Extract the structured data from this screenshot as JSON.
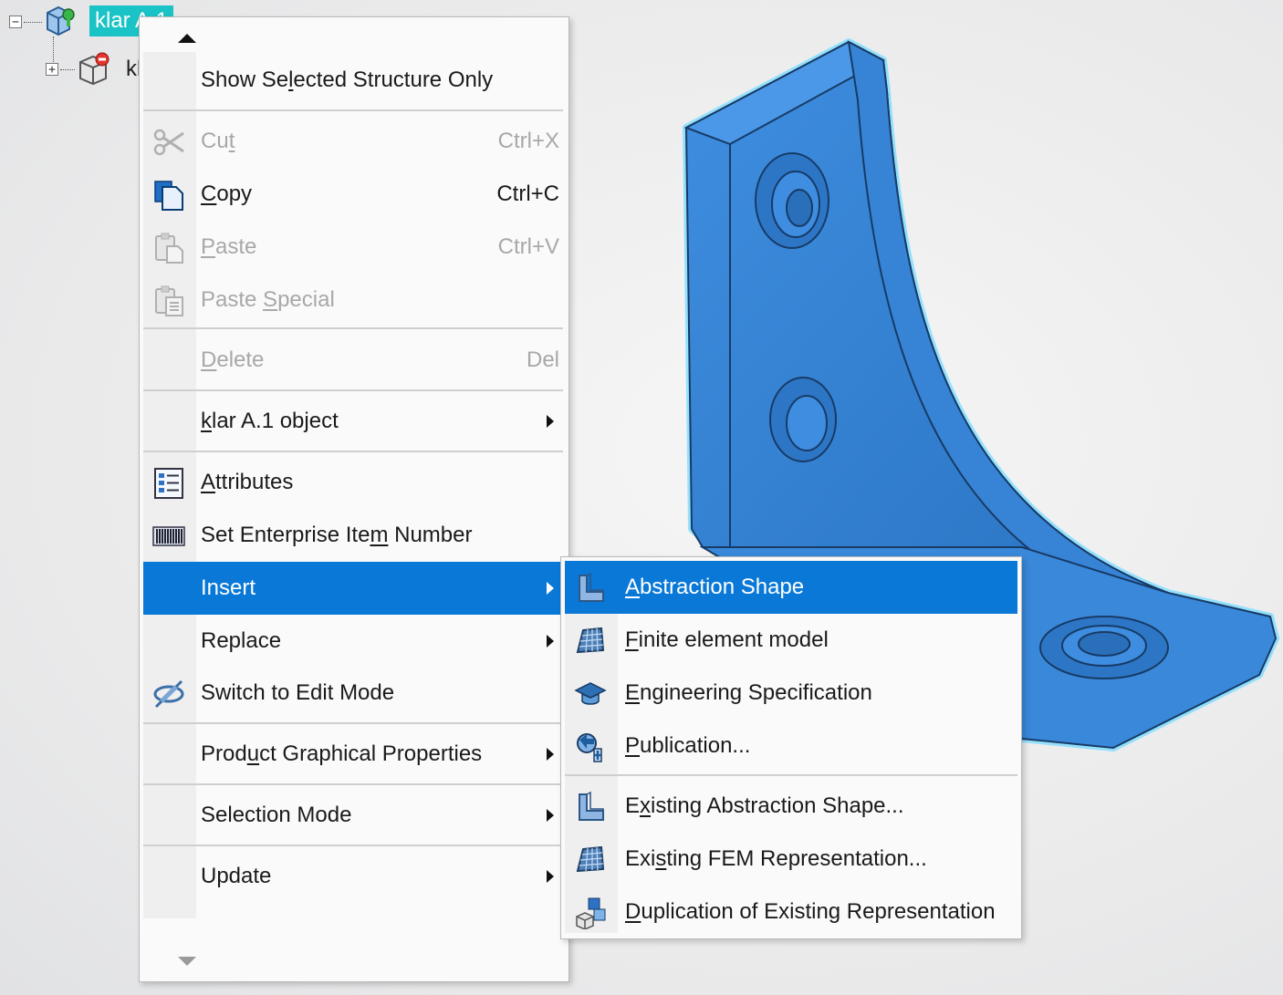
{
  "tree": {
    "root_label": "klar A.1",
    "child_label": "klar",
    "expand_root": "−",
    "expand_child": "+"
  },
  "context_menu": {
    "items": [
      {
        "label_pre": "Show Se",
        "label_u": "l",
        "label_post": "ected Structure Only",
        "shortcut": "",
        "enabled": true
      },
      {
        "label_pre": "Cu",
        "label_u": "t",
        "label_post": "",
        "shortcut": "Ctrl+X",
        "enabled": false
      },
      {
        "label_pre": "",
        "label_u": "C",
        "label_post": "opy",
        "shortcut": "Ctrl+C",
        "enabled": true
      },
      {
        "label_pre": "",
        "label_u": "P",
        "label_post": "aste",
        "shortcut": "Ctrl+V",
        "enabled": false
      },
      {
        "label_pre": "Paste ",
        "label_u": "S",
        "label_post": "pecial",
        "shortcut": "",
        "enabled": false
      },
      {
        "label_pre": "",
        "label_u": "D",
        "label_post": "elete",
        "shortcut": "Del",
        "enabled": false
      },
      {
        "label_pre": "",
        "label_u": "k",
        "label_post": "lar A.1 object",
        "shortcut": "",
        "enabled": true
      },
      {
        "label_pre": "",
        "label_u": "A",
        "label_post": "ttributes",
        "shortcut": "",
        "enabled": true
      },
      {
        "label_pre": "Set Enterprise Ite",
        "label_u": "m",
        "label_post": " Number",
        "shortcut": "",
        "enabled": true
      },
      {
        "label_pre": "Insert",
        "label_u": "",
        "label_post": "",
        "shortcut": "",
        "enabled": true
      },
      {
        "label_pre": "Replace",
        "label_u": "",
        "label_post": "",
        "shortcut": "",
        "enabled": true
      },
      {
        "label_pre": "Switch to Edit Mode",
        "label_u": "",
        "label_post": "",
        "shortcut": "",
        "enabled": true
      },
      {
        "label_pre": "Prod",
        "label_u": "u",
        "label_post": "ct Graphical Properties",
        "shortcut": "",
        "enabled": true
      },
      {
        "label_pre": "Selection Mode",
        "label_u": "",
        "label_post": "",
        "shortcut": "",
        "enabled": true
      },
      {
        "label_pre": "Update",
        "label_u": "",
        "label_post": "",
        "shortcut": "",
        "enabled": true
      }
    ]
  },
  "submenu": {
    "items": [
      {
        "label_pre": "",
        "label_u": "A",
        "label_post": "bstraction Shape",
        "enabled": true
      },
      {
        "label_pre": "",
        "label_u": "F",
        "label_post": "inite element model",
        "enabled": true
      },
      {
        "label_pre": "",
        "label_u": "E",
        "label_post": "ngineering Specification",
        "enabled": true
      },
      {
        "label_pre": "",
        "label_u": "P",
        "label_post": "ublication...",
        "enabled": true
      },
      {
        "label_pre": "E",
        "label_u": "x",
        "label_post": "isting Abstraction Shape...",
        "enabled": true
      },
      {
        "label_pre": "Exi",
        "label_u": "s",
        "label_post": "ting FEM Representation...",
        "enabled": true
      },
      {
        "label_pre": "",
        "label_u": "D",
        "label_post": "uplication of Existing Representation",
        "enabled": true
      }
    ]
  },
  "colors": {
    "highlight": "#0a78d7",
    "tree_selection": "#19c3c6",
    "part_blue": "#2f7fd0",
    "part_edge_glow": "#5fd3ff"
  }
}
